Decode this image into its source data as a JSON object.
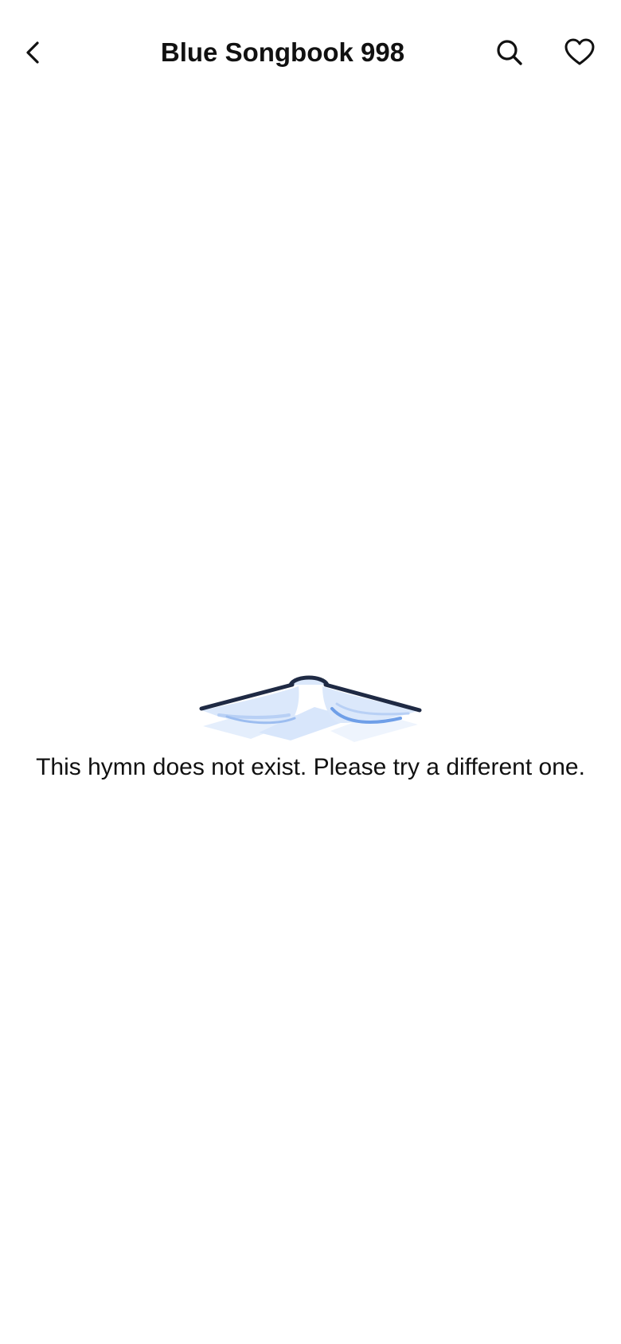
{
  "header": {
    "title": "Blue Songbook 998",
    "back_icon": "chevron-left-icon",
    "search_icon": "search-icon",
    "favorite_icon": "heart-icon"
  },
  "empty_state": {
    "illustration": "open-book-icon",
    "message": "This hymn does not exist. Please try a different one."
  },
  "colors": {
    "background": "#ffffff",
    "text": "#111111",
    "book_cover": "#1f2a44",
    "book_pages_light": "#dbe8fb",
    "book_pages_accent": "#6f9fe8"
  }
}
